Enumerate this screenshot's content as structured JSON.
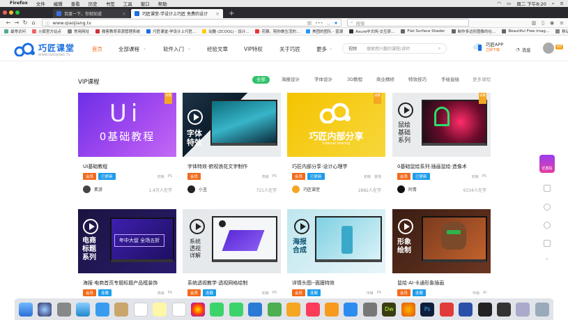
{
  "macbar": {
    "app": "Firefox",
    "menus": [
      "文件",
      "编辑",
      "查看",
      "历史",
      "书签",
      "工具",
      "窗口",
      "帮助"
    ],
    "clock": "周二 下午8:20"
  },
  "tabs": [
    {
      "title": "百度一下，你就知道",
      "active": false,
      "color": "#3a6fe0"
    },
    {
      "title": "巧匠课堂-学设计上巧匠 免费的设计",
      "active": true,
      "color": "#1a6ee0"
    }
  ],
  "address": {
    "url": "www.qiaojiang.tv",
    "search_placeholder": "搜索"
  },
  "bookmarks": [
    "最常访问",
    "火狐官方站点",
    "常用网址",
    "微客教育资源管理系统",
    "巧匠课堂-学设计上巧匠...",
    "站酷 (ZCOOL) - 设计...",
    "花瓣，陪你做生活的...",
    "美团的团队 - 蓝湖",
    "Axure中文网-交互原...",
    "Flat Surface Shader",
    "制作多边形图像的在...",
    "Beautiful Free imag..."
  ],
  "bookmark_right": "移动版书签",
  "site": {
    "logo_cn": "巧匠课堂",
    "logo_en": "WWW.QIAOJIANG.TV",
    "nav": [
      "首页",
      "全部课程",
      "软件入门",
      "经验文章",
      "VIP特权",
      "关于巧匠",
      "更多"
    ],
    "search_select": "视频",
    "search_placeholder": "搜索感兴趣的课程/讲师",
    "app_label": "巧匠APP",
    "app_sub": "立即下载",
    "msg_label": "消息",
    "vip_tag": "VIP"
  },
  "section": {
    "title": "VIP课程",
    "filters": [
      "全部",
      "海报设计",
      "字体设计",
      "3D教程",
      "商业精修",
      "特效技巧",
      "手绘鼠绘",
      "更多课程"
    ],
    "active_filter": "全部"
  },
  "cards": [
    {
      "title": "UI基础教程",
      "badges": [
        "会员",
        "已更新"
      ],
      "tags": [
        "初级",
        "PS"
      ],
      "author": "素游",
      "learners": "1.4万人在学",
      "thumb_text": "0基础教程",
      "thumb_sub": "Ui",
      "corner": "试看"
    },
    {
      "title": "字体特效·俯视浪花文字制作",
      "badges": [
        "会员"
      ],
      "tags": [
        "高级",
        "PS"
      ],
      "author": "小丑",
      "learners": "721人在学",
      "thumb_text": "字体特效"
    },
    {
      "title": "巧匠内部分享-设计心理学",
      "badges": [
        "会员",
        "已更新"
      ],
      "tags": [
        "初级",
        "其他"
      ],
      "author": "巧匠课堂",
      "learners": "2882人在学",
      "thumb_text": "巧匠内部分享",
      "thumb_sub": "internal sharing",
      "corner": "试看"
    },
    {
      "title": "0基础鼠绘系列·插画鼠绘·造像术",
      "badges": [
        "会员",
        "已更新"
      ],
      "tags": [
        "初级",
        "PS"
      ],
      "author": "阿青",
      "learners": "6334人在学",
      "thumb_text": "鼠绘基础系列",
      "corner": "试看"
    },
    {
      "title": "海报·电商首页专题标题产品框装饰",
      "badges": [
        "会员",
        "连载"
      ],
      "tags": [
        "高级",
        "PS"
      ],
      "thumb_text": "电商标题系列",
      "thumb_sub": "年中大促 全场五折"
    },
    {
      "title": "系统透视教学·透视网格绘制",
      "badges": [
        "会员",
        "连载"
      ],
      "tags": [
        "初级",
        "PS"
      ],
      "thumb_text": "系统透视详解"
    },
    {
      "title": "详情头图--面膜特效",
      "badges": [
        "会员",
        "连载"
      ],
      "tags": [
        "中级",
        "PS"
      ],
      "thumb_text": "海报合成"
    },
    {
      "title": "鼠绘·AI·卡通形象插画",
      "badges": [
        "会员",
        "连载"
      ],
      "tags": [
        "中级",
        "AI"
      ],
      "thumb_text": "形象绘制"
    }
  ],
  "side": {
    "promo": "优惠码"
  }
}
